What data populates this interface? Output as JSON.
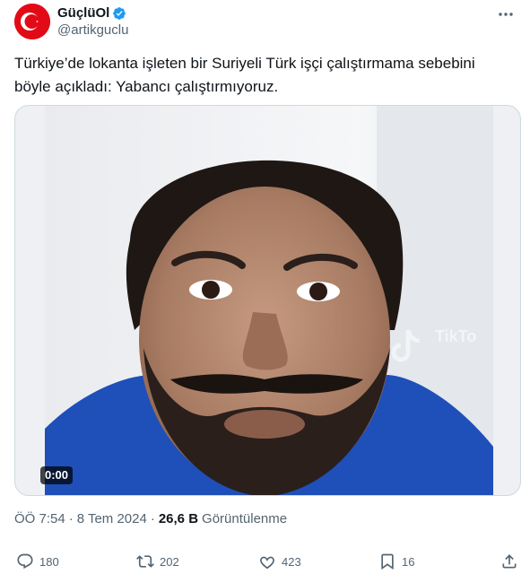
{
  "author": {
    "display_name": "GüçlüOl",
    "handle": "@artikguclu",
    "verified_color": "#1d9bf0",
    "avatar_icon": "turkish-flag-icon"
  },
  "tweet": {
    "text": "Türkiye’de lokanta işleten bir Suriyeli Türk işçi çalıştırmama sebebini böyle açıkladı: Yabancı çalıştırmıyoruz."
  },
  "media": {
    "duration": "0:00",
    "watermark_icon": "tiktok-icon",
    "watermark_text": "TikTo"
  },
  "meta": {
    "time": "ÖÖ 7:54",
    "separator1": "·",
    "date": "8 Tem 2024",
    "separator2": "·",
    "views_count": "26,6 B",
    "views_label": "Görüntülenme"
  },
  "actions": {
    "replies": "180",
    "reposts": "202",
    "likes": "423",
    "bookmarks": "16"
  }
}
